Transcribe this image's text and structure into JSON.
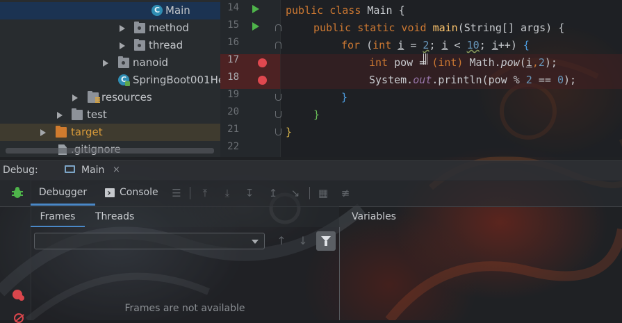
{
  "project_tree": {
    "items": [
      {
        "label": "Main",
        "type": "class",
        "selected": true
      },
      {
        "label": "method",
        "type": "package"
      },
      {
        "label": "thread",
        "type": "package"
      },
      {
        "label": "nanoid",
        "type": "package"
      },
      {
        "label": "SpringBoot001He",
        "type": "class"
      },
      {
        "label": "resources",
        "type": "resources-folder"
      },
      {
        "label": "test",
        "type": "folder"
      },
      {
        "label": "target",
        "type": "folder",
        "color": "#d07b2e"
      },
      {
        "label": ".gitignore",
        "type": "file"
      }
    ]
  },
  "editor": {
    "line_numbers": [
      "14",
      "15",
      "16",
      "17",
      "18",
      "19",
      "20",
      "21",
      "22"
    ],
    "breakpoint_lines": [
      "17",
      "18"
    ],
    "run_lines": [
      "14",
      "15"
    ],
    "code": {
      "l14_kw": "public class",
      "l14_name": "Main",
      "l14_brace": "{",
      "l15_kw": "public static void",
      "l15_fn": "main",
      "l15_params": "(String[] args)",
      "l15_brace": "{",
      "l16_kw": "for",
      "l16_open": "(",
      "l16_int": "int",
      "l16_i1": "i",
      "l16_eq": " = ",
      "l16_n2": "2",
      "l16_semi1": "; ",
      "l16_i2": "i",
      "l16_lt": " < ",
      "l16_n10": "10",
      "l16_semi2": "; ",
      "l16_i3": "i",
      "l16_inc": "++) ",
      "l16_brace": "{",
      "l17_int": "int",
      "l17_a": " pow = ",
      "l17_cast": "(int)",
      "l17_math": " Math.",
      "l17_pow": "pow",
      "l17_open": "(",
      "l17_i": "i",
      "l17_comma": ",",
      "l17_2": "2",
      "l17_close": ");",
      "l18_sys": "System.",
      "l18_out": "out",
      "l18_println": ".println(pow % ",
      "l18_2": "2",
      "l18_eq": " == ",
      "l18_0": "0",
      "l18_close": ");",
      "l19_brace": "}",
      "l20_brace": "}",
      "l21_brace": "}"
    }
  },
  "debug": {
    "title": "Debug:",
    "session_tab": "Main",
    "close_symbol": "×",
    "tabs": {
      "debugger": "Debugger",
      "console": "Console"
    },
    "frames_tabs": {
      "frames": "Frames",
      "threads": "Threads"
    },
    "variables_title": "Variables",
    "frames_empty": "Frames are not available",
    "thread_select_value": "",
    "toolbar_icons": [
      "menu-icon",
      "show-execution-point-icon",
      "step-over-icon",
      "step-into-icon",
      "force-step-into-icon",
      "step-out-icon",
      "run-to-cursor-icon",
      "evaluate-expression-icon",
      "trace-icon"
    ]
  },
  "colors": {
    "keyword": "#cc7832",
    "function": "#ffc66d",
    "number": "#6897bb",
    "static_field": "#9876aa",
    "breakpoint": "#e0484f",
    "run": "#4eb44a",
    "selection": "#1a3454",
    "accent_tab": "#4a88c7"
  }
}
